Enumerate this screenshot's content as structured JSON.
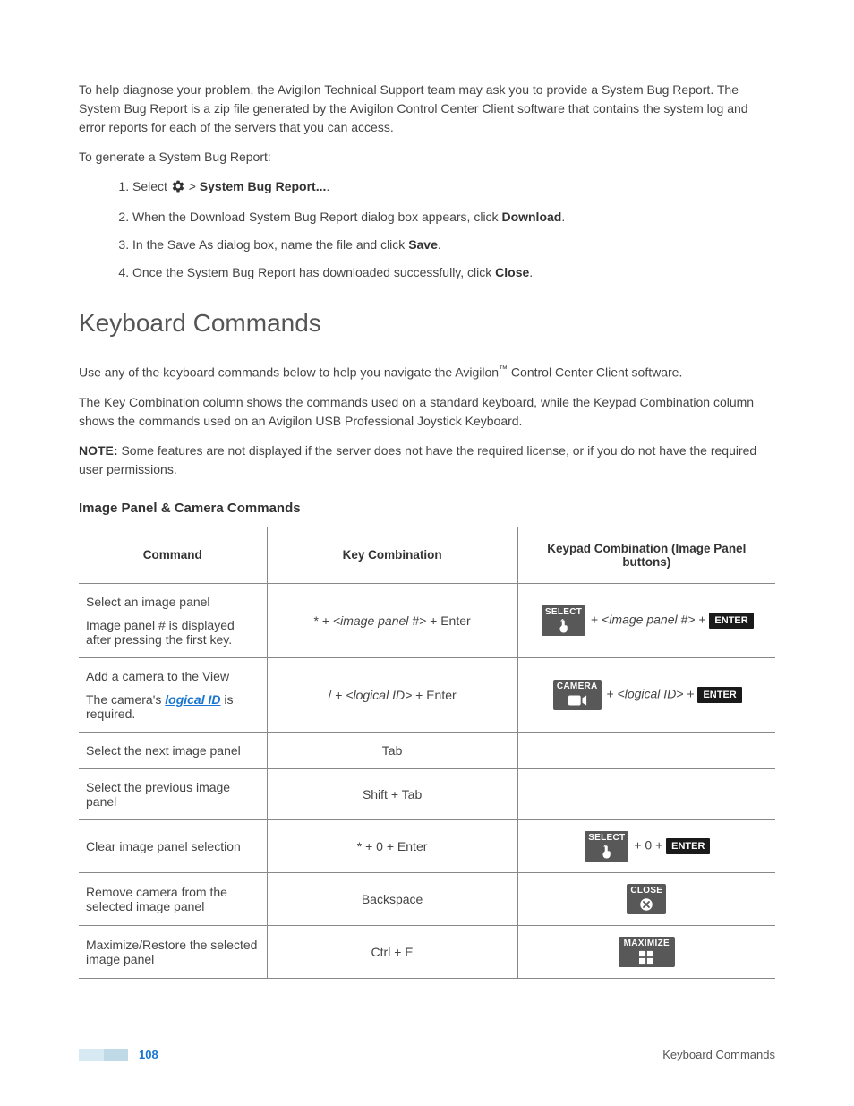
{
  "intro": {
    "p1": "To help diagnose your problem, the Avigilon Technical Support team may ask you to provide a System Bug Report. The System Bug Report is a zip file generated by the Avigilon Control Center Client software that contains the system log and error reports for each of the servers that you can access.",
    "p2": "To generate a System Bug Report:"
  },
  "steps": {
    "s1_before": "Select ",
    "s1_middle": " > ",
    "s1_bold": "System Bug Report...",
    "s1_after": ".",
    "s2_before": "When the Download System Bug Report dialog box appears, click ",
    "s2_bold": "Download",
    "s2_after": ".",
    "s3_before": "In the Save As dialog box, name the file and click ",
    "s3_bold": "Save",
    "s3_after": ".",
    "s4_before": "Once the System Bug Report has downloaded successfully, click ",
    "s4_bold": "Close",
    "s4_after": "."
  },
  "heading": "Keyboard Commands",
  "body": {
    "p1_before": "Use any of the keyboard commands below to help you navigate the Avigilon",
    "p1_tm": "™",
    "p1_after": " Control Center Client software.",
    "p2": "The Key Combination column shows the commands used on a standard keyboard, while the Keypad Combination column shows the commands used on an Avigilon USB Professional Joystick Keyboard.",
    "note_label": "NOTE: ",
    "note_text": "Some features are not displayed if the server does not have the required license, or if you do not have the required user permissions."
  },
  "subheading": "Image Panel & Camera Commands",
  "table": {
    "headers": [
      "Command",
      "Key Combination",
      "Keypad Combination (Image Panel buttons)"
    ],
    "rows": [
      {
        "cmd": "Select an image panel",
        "cmd_note": "Image panel # is displayed after pressing the first key.",
        "key_before": "* + ",
        "key_var": "<image panel #>",
        "key_after": " + Enter",
        "keypad_btn_label": "SELECT",
        "keypad_var_before": " + ",
        "keypad_var": "<image panel #>",
        "keypad_var_after": " + ",
        "keypad_enter": "ENTER"
      },
      {
        "cmd": "Add a camera to the View",
        "cmd_note_before": "The camera's ",
        "cmd_note_link": "logical ID",
        "cmd_note_after": " is required.",
        "key_before": "/ + ",
        "key_var": "<logical ID>",
        "key_after": " + Enter",
        "keypad_btn_label": "CAMERA",
        "keypad_var_before": " + ",
        "keypad_var": "<logical ID>",
        "keypad_var_after": " + ",
        "keypad_enter": "ENTER"
      },
      {
        "cmd": "Select the next image panel",
        "key": "Tab"
      },
      {
        "cmd": "Select the previous image panel",
        "key": "Shift + Tab"
      },
      {
        "cmd": "Clear image panel selection",
        "key": "* + 0 + Enter",
        "keypad_btn_label": "SELECT",
        "keypad_var_before": " + 0 + ",
        "keypad_enter": "ENTER"
      },
      {
        "cmd": "Remove camera from the selected image panel",
        "key": "Backspace",
        "keypad_btn_label": "CLOSE"
      },
      {
        "cmd": "Maximize/Restore the selected image panel",
        "key": "Ctrl + E",
        "keypad_btn_label": "MAXIMIZE"
      }
    ]
  },
  "footer": {
    "page": "108",
    "right": "Keyboard Commands"
  }
}
